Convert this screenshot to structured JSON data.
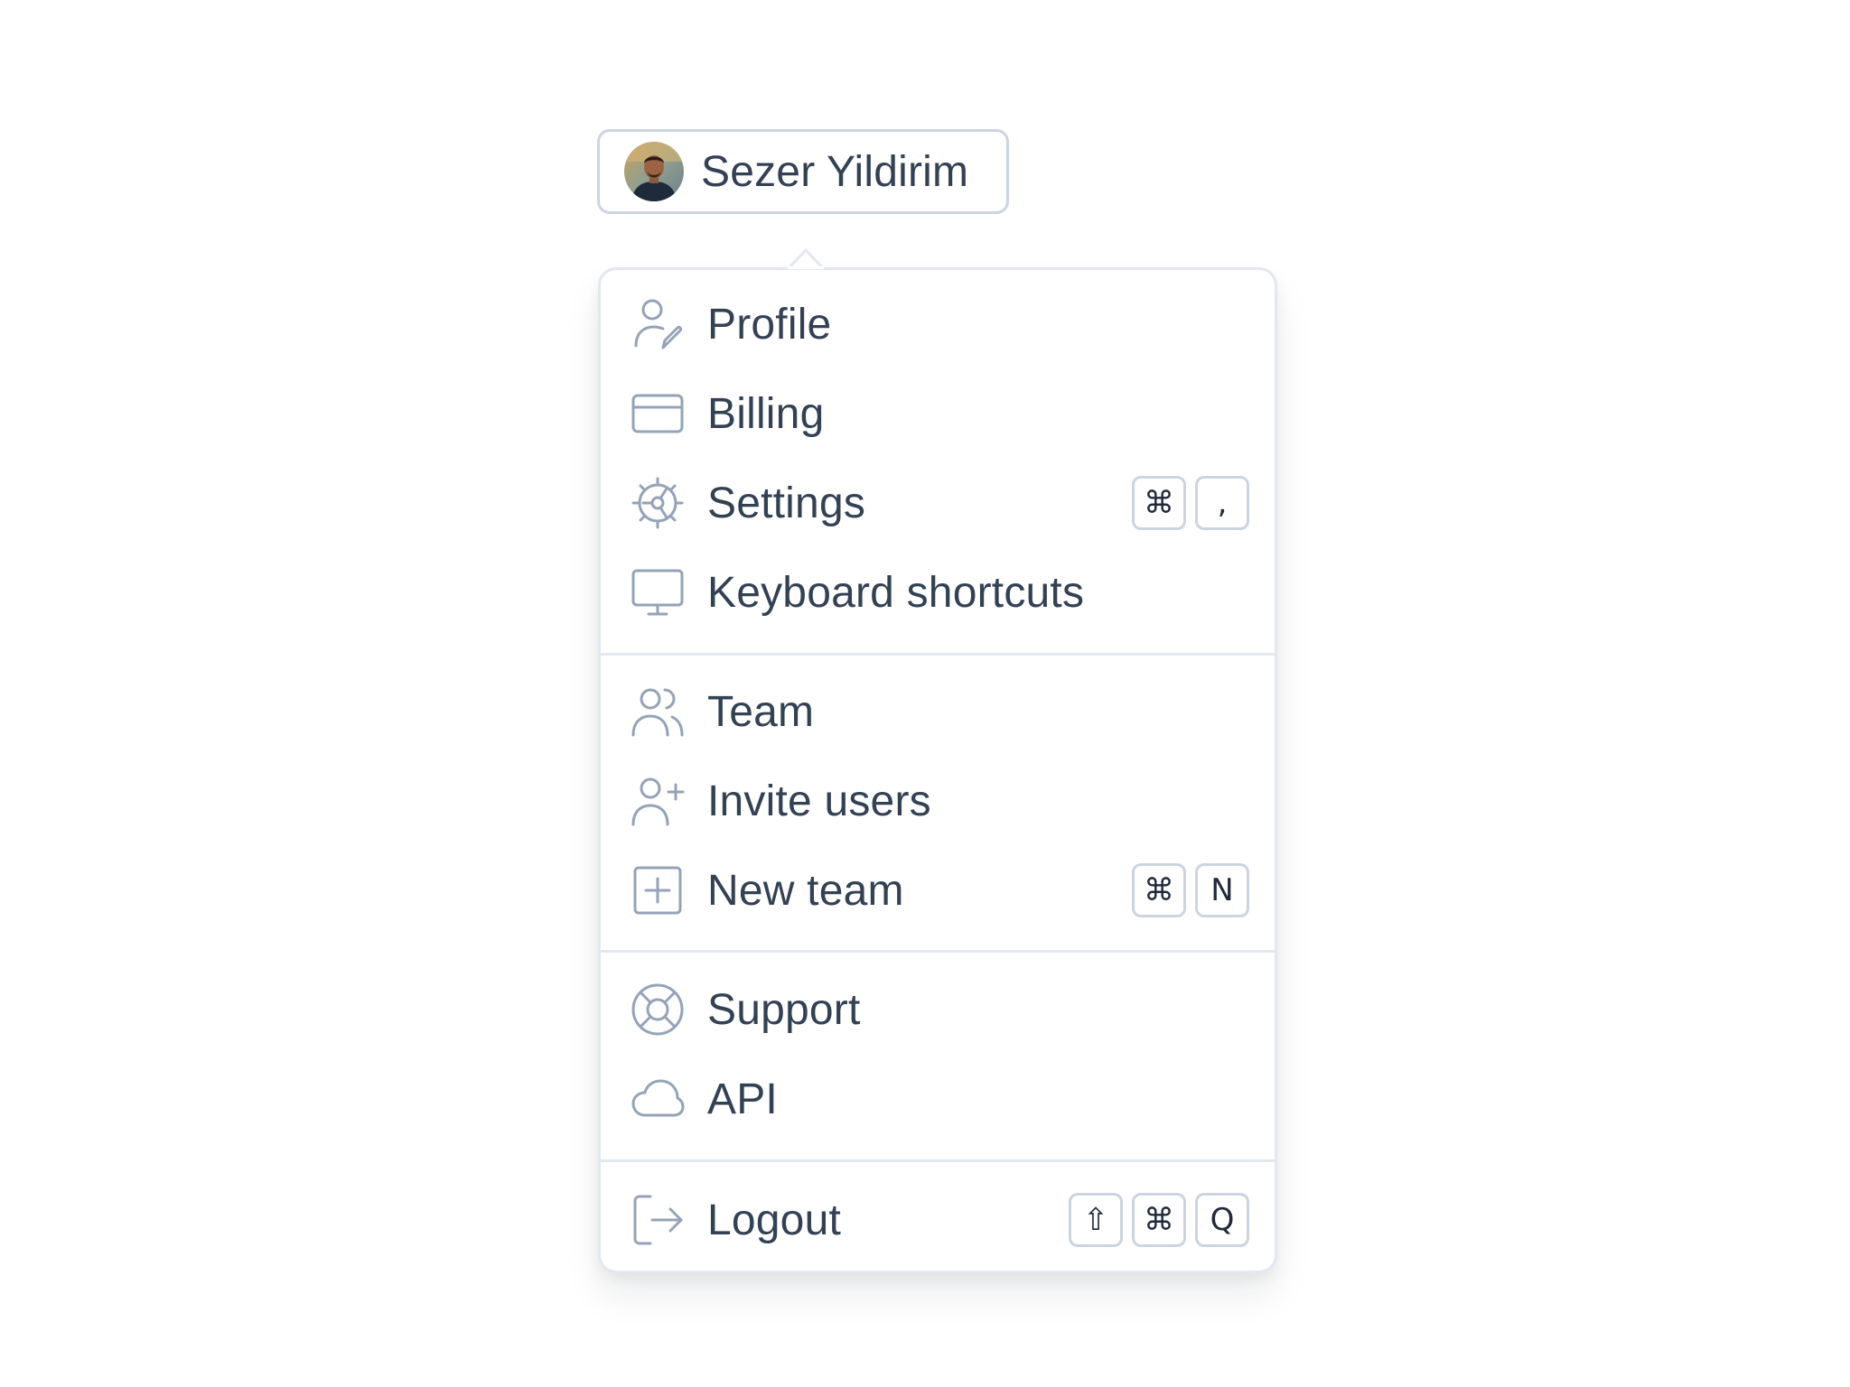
{
  "user": {
    "name": "Sezer Yildirim"
  },
  "menu": {
    "sections": [
      {
        "items": [
          {
            "label": "Profile",
            "icon": "user-edit-icon"
          },
          {
            "label": "Billing",
            "icon": "credit-card-icon"
          },
          {
            "label": "Settings",
            "icon": "settings-gear-icon",
            "shortcut": [
              "⌘",
              ","
            ]
          },
          {
            "label": "Keyboard shortcuts",
            "icon": "monitor-icon"
          }
        ]
      },
      {
        "items": [
          {
            "label": "Team",
            "icon": "users-icon"
          },
          {
            "label": "Invite users",
            "icon": "user-plus-icon"
          },
          {
            "label": "New team",
            "icon": "plus-square-icon",
            "shortcut": [
              "⌘",
              "N"
            ]
          }
        ]
      },
      {
        "items": [
          {
            "label": "Support",
            "icon": "life-buoy-icon"
          },
          {
            "label": "API",
            "icon": "cloud-icon"
          }
        ]
      },
      {
        "items": [
          {
            "label": "Logout",
            "icon": "logout-icon",
            "shortcut": [
              "⇧",
              "⌘",
              "Q"
            ]
          }
        ]
      }
    ]
  },
  "colors": {
    "text": "#334155",
    "icon": "#94a3b8",
    "border": "#cbd5e1",
    "divider": "#e2e8f0",
    "background": "#ffffff"
  }
}
